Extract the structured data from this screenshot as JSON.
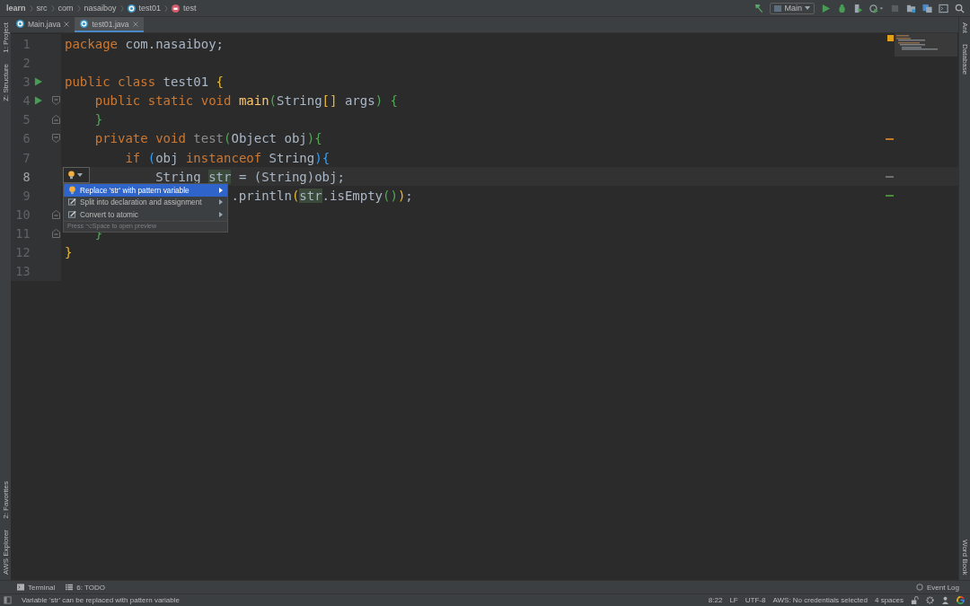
{
  "breadcrumbs": [
    {
      "label": "learn",
      "kind": "folder"
    },
    {
      "label": "src",
      "kind": "folder"
    },
    {
      "label": "com",
      "kind": "folder"
    },
    {
      "label": "nasaiboy",
      "kind": "folder"
    },
    {
      "label": "test01",
      "kind": "class"
    },
    {
      "label": "test",
      "kind": "method"
    }
  ],
  "run_config": "Main",
  "tabs": [
    {
      "label": "Main.java",
      "selected": false
    },
    {
      "label": "test01.java",
      "selected": true
    }
  ],
  "left_stripe": {
    "top": [
      "1: Project",
      "Z: Structure"
    ],
    "bottom": [
      "2: Favorites",
      "AWS Explorer"
    ]
  },
  "right_stripe": {
    "top": [
      "Ant",
      "Database"
    ],
    "bottom": [
      "Word Book"
    ]
  },
  "lines": [
    {
      "number": "1",
      "kind": "plain",
      "run": false,
      "current": false,
      "tokens": [
        {
          "kind": "kw",
          "text": "package"
        },
        {
          "kind": "plain",
          "text": " com.nasaiboy;"
        }
      ]
    },
    {
      "number": "2",
      "kind": "plain",
      "run": false,
      "current": false
    },
    {
      "number": "3",
      "kind": "plain",
      "run": true,
      "current": false,
      "tokens": [
        {
          "kind": "kw",
          "text": "public class "
        },
        {
          "kind": "plain",
          "text": "test01 "
        },
        {
          "kind": "br1",
          "text": "{"
        }
      ]
    },
    {
      "number": "4",
      "kind": "fold-start",
      "run": true,
      "current": false,
      "tokens": [
        {
          "kind": "kw",
          "text": "    public static void "
        },
        {
          "kind": "fn",
          "text": "main"
        },
        {
          "kind": "br2",
          "text": "("
        },
        {
          "kind": "plain",
          "text": "String"
        },
        {
          "kind": "br1",
          "text": "[]"
        },
        {
          "kind": "plain",
          "text": " args"
        },
        {
          "kind": "br2",
          "text": ")"
        },
        {
          "kind": "br2",
          "text": " {"
        }
      ]
    },
    {
      "number": "5",
      "kind": "fold-end",
      "run": false,
      "current": false,
      "tokens": [
        {
          "kind": "br2",
          "text": "    }"
        }
      ]
    },
    {
      "number": "6",
      "kind": "fold-start",
      "run": false,
      "current": false,
      "color": "#be7b2c",
      "tokens": [
        {
          "kind": "kw",
          "text": "    private void "
        },
        {
          "kind": "unused",
          "text": "test"
        },
        {
          "kind": "br2",
          "text": "("
        },
        {
          "kind": "plain",
          "text": "Object obj"
        },
        {
          "kind": "br2",
          "text": ")"
        },
        {
          "kind": "br2",
          "text": "{"
        }
      ]
    },
    {
      "number": "7",
      "kind": "plain",
      "run": false,
      "current": false,
      "tokens": [
        {
          "kind": "kw",
          "text": "        if "
        },
        {
          "kind": "br3",
          "text": "("
        },
        {
          "kind": "plain",
          "text": "obj "
        },
        {
          "kind": "kw",
          "text": "instanceof "
        },
        {
          "kind": "plain",
          "text": "String"
        },
        {
          "kind": "br3",
          "text": ")"
        },
        {
          "kind": "br3",
          "text": "{"
        }
      ]
    },
    {
      "number": "8",
      "kind": "plain",
      "run": false,
      "current": true,
      "color": "#6e6e6e",
      "tokens": [
        {
          "kind": "plain",
          "text": "            String "
        },
        {
          "kind": "hl",
          "text": "str"
        },
        {
          "kind": "plain",
          "text": " = (String)obj;"
        }
      ]
    },
    {
      "number": "9",
      "kind": "plain",
      "run": false,
      "current": false,
      "color": "#4e8a3e",
      "tokens": [
        {
          "kind": "plain",
          "text": "                      .println"
        },
        {
          "kind": "br1",
          "text": "("
        },
        {
          "kind": "hl",
          "text": "str"
        },
        {
          "kind": "plain",
          "text": ".isEmpty"
        },
        {
          "kind": "br2",
          "text": "()"
        },
        {
          "kind": "br1",
          "text": ")"
        },
        {
          "kind": "plain",
          "text": ";"
        }
      ]
    },
    {
      "number": "10",
      "kind": "fold-end",
      "run": false,
      "current": false
    },
    {
      "number": "11",
      "kind": "fold-end",
      "run": false,
      "current": false,
      "tokens": [
        {
          "kind": "br2",
          "text": "    }"
        }
      ]
    },
    {
      "number": "12",
      "kind": "plain",
      "run": false,
      "current": false,
      "tokens": [
        {
          "kind": "br1",
          "text": "}"
        }
      ]
    },
    {
      "number": "13",
      "kind": "plain",
      "run": false,
      "current": false
    }
  ],
  "intention_menu": {
    "items": [
      {
        "label": "Replace 'str' with pattern variable",
        "kind": "bulb",
        "selected": true
      },
      {
        "label": "Split into declaration and assignment",
        "kind": "edit",
        "selected": false
      },
      {
        "label": "Convert to atomic",
        "kind": "edit",
        "selected": false
      }
    ],
    "hint": "Press ⌥Space to open preview"
  },
  "tool_windows": [
    {
      "label": "Terminal",
      "kind": "terminal"
    },
    {
      "label": "6: TODO",
      "kind": "list"
    }
  ],
  "event_log": "Event Log",
  "status_message": "Variable 'str' can be replaced with pattern variable",
  "status_items": [
    "8:22",
    "LF",
    "UTF-8",
    "AWS: No credentials selected",
    "4 spaces"
  ]
}
